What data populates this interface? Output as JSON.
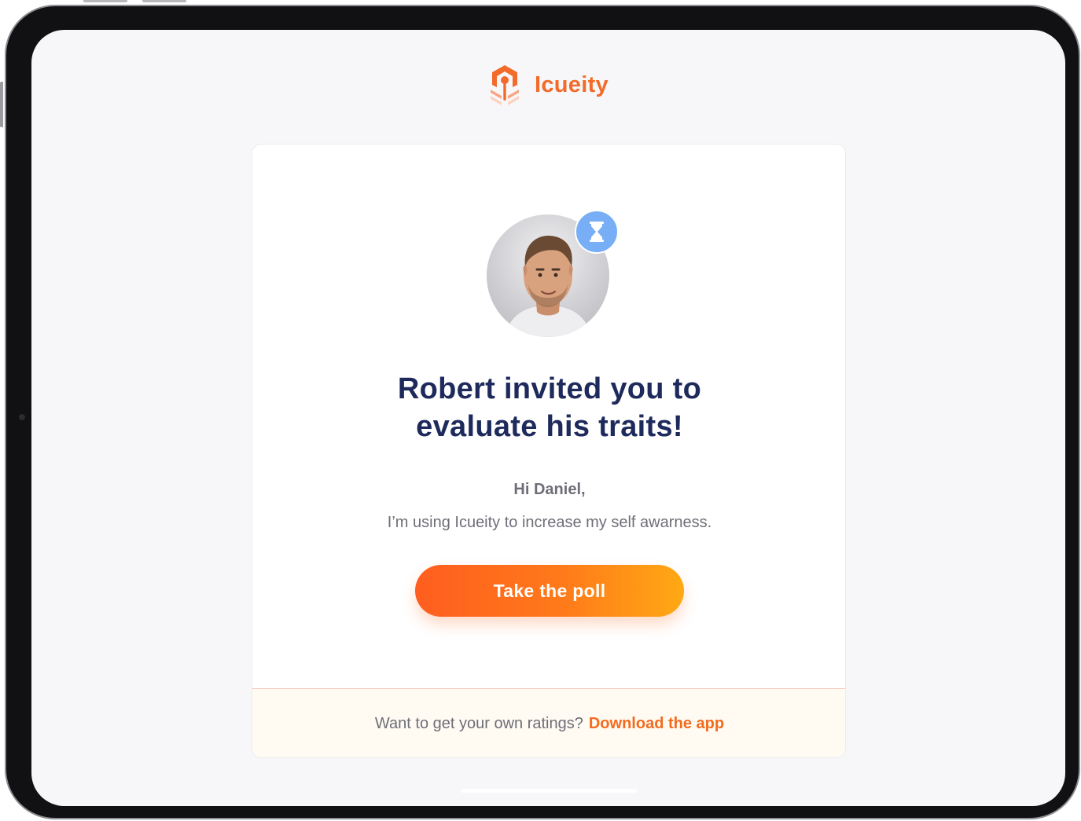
{
  "brand": {
    "name": "Icueity",
    "logo_icon": "icueity-logo-icon",
    "color": "#f26b2a"
  },
  "invite": {
    "avatar_icon": "user-avatar-photo",
    "status_icon": "hourglass-icon",
    "status_color": "#77aef5",
    "headline_line1": "Robert invited you to",
    "headline_line2": "evaluate his traits!",
    "greeting": "Hi Daniel,",
    "message": "I’m using Icueity to increase my self awarness.",
    "cta_label": "Take the poll"
  },
  "footer": {
    "text": "Want to get your own ratings?",
    "link_label": "Download the app",
    "link_color": "#f26b1f"
  }
}
